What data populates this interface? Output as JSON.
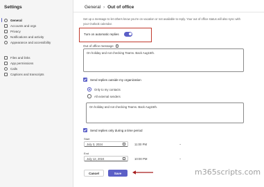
{
  "sidebar": {
    "title": "Settings",
    "items": [
      {
        "label": "General",
        "icon": "gear-icon",
        "active": true
      },
      {
        "label": "Accounts and orgs",
        "icon": "accounts-icon"
      },
      {
        "label": "Privacy",
        "icon": "lock-icon"
      },
      {
        "label": "Notifications and activity",
        "icon": "bell-icon"
      },
      {
        "label": "Appearance and accessibility",
        "icon": "palette-icon"
      },
      {
        "label": "Files and links",
        "icon": "file-icon"
      },
      {
        "label": "App permissions",
        "icon": "grid-icon"
      },
      {
        "label": "Calls",
        "icon": "phone-icon"
      },
      {
        "label": "Captions and transcripts",
        "icon": "captions-icon"
      }
    ]
  },
  "header": {
    "breadcrumb_parent": "General",
    "breadcrumb_separator": "›",
    "title": "Out of office"
  },
  "intro": "Set up a message to let others know you're on vacation or not available to reply. Your out of office status will also sync with your Outlook calendar.",
  "auto_replies": {
    "label": "Turn on automatic replies",
    "on": true
  },
  "message": {
    "label": "Out of office message",
    "value": "On holiday and not checking Teams. Back Aug15th."
  },
  "outside": {
    "label": "Send replies outside my organization",
    "checked": true,
    "options": [
      "Only to my contacts",
      "All external senders"
    ],
    "selected": 0,
    "message_value": "On holiday and not checking Teams. Back Aug15th."
  },
  "period": {
    "label": "Send replies only during a time period",
    "checked": true,
    "start_label": "Start",
    "start_date": "July 3, 2024",
    "start_time": "11:00 PM",
    "end_label": "End",
    "end_date": "July 12, 2024",
    "end_time": "10:00 PM"
  },
  "buttons": {
    "cancel": "Cancel",
    "save": "Save"
  },
  "watermark": "m365scripts.com",
  "colors": {
    "accent": "#5b5fc7",
    "highlight": "#c0392b"
  }
}
